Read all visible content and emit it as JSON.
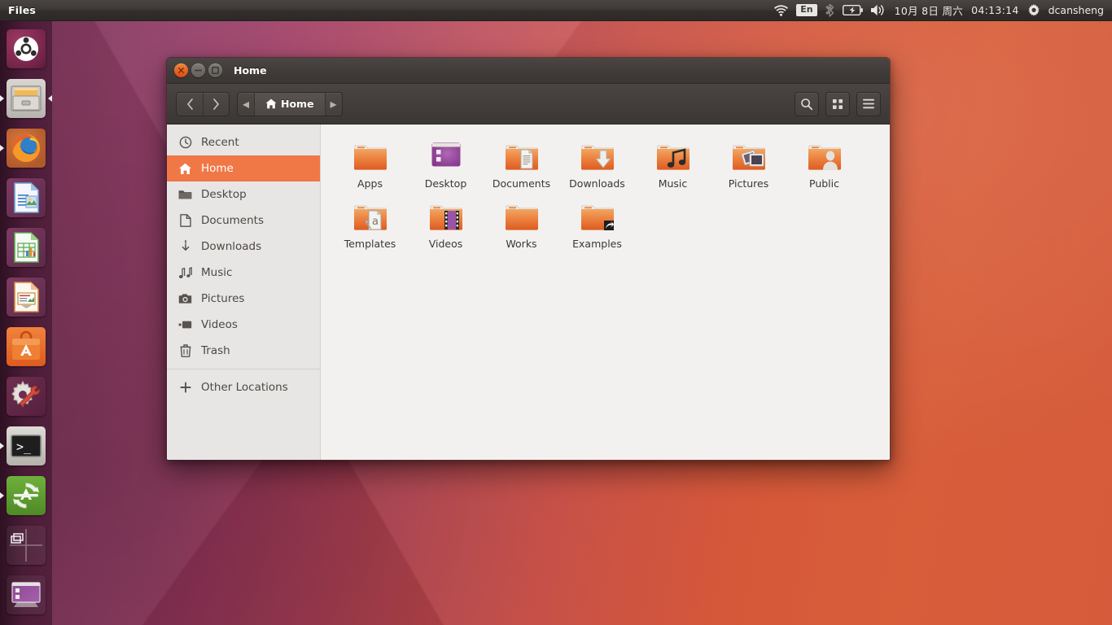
{
  "top_panel": {
    "app_menu_title": "Files",
    "indicators": {
      "wifi_icon": "wifi-icon",
      "keyboard_label": "En",
      "bluetooth_icon": "bluetooth-icon",
      "battery_icon": "battery-charging-icon",
      "volume_icon": "volume-icon",
      "date": "10月 8日 周六",
      "time": "04:13:14",
      "session_icon": "gear-icon",
      "username": "dcansheng"
    }
  },
  "launcher": {
    "items": [
      {
        "name": "dash-home",
        "icon": "ubuntu-logo-icon",
        "running": false,
        "focused": false
      },
      {
        "name": "files",
        "icon": "file-cabinet-icon",
        "running": true,
        "focused": true
      },
      {
        "name": "firefox",
        "icon": "firefox-icon",
        "running": true,
        "focused": false
      },
      {
        "name": "libreoffice-writer",
        "icon": "writer-icon",
        "running": false,
        "focused": false
      },
      {
        "name": "libreoffice-calc",
        "icon": "calc-icon",
        "running": false,
        "focused": false
      },
      {
        "name": "libreoffice-impress",
        "icon": "impress-icon",
        "running": false,
        "focused": false
      },
      {
        "name": "ubuntu-software",
        "icon": "software-center-icon",
        "running": false,
        "focused": false
      },
      {
        "name": "system-settings",
        "icon": "gear-wrench-icon",
        "running": false,
        "focused": false
      },
      {
        "name": "terminal",
        "icon": "terminal-icon",
        "running": true,
        "focused": false
      },
      {
        "name": "software-updater",
        "icon": "updater-icon",
        "running": true,
        "focused": false
      },
      {
        "name": "workspace-switcher",
        "icon": "workspace-switcher-icon",
        "running": false,
        "focused": false
      },
      {
        "name": "show-desktop",
        "icon": "show-desktop-icon",
        "running": false,
        "focused": false
      }
    ]
  },
  "window": {
    "title": "Home",
    "buttons": {
      "close": "close-icon",
      "minimize": "minimize-icon",
      "maximize": "maximize-icon"
    },
    "toolbar": {
      "back_label": "‹",
      "forward_label": "›",
      "path_prev_label": "◂",
      "path_next_label": "▸",
      "breadcrumb": "Home",
      "search_icon": "search-icon",
      "view_grid_icon": "grid-view-icon",
      "menu_icon": "hamburger-menu-icon"
    }
  },
  "sidebar": {
    "items": [
      {
        "label": "Recent",
        "icon": "clock-icon",
        "selected": false
      },
      {
        "label": "Home",
        "icon": "home-icon",
        "selected": true
      },
      {
        "label": "Desktop",
        "icon": "folder-icon",
        "selected": false
      },
      {
        "label": "Documents",
        "icon": "document-icon",
        "selected": false
      },
      {
        "label": "Downloads",
        "icon": "download-icon",
        "selected": false
      },
      {
        "label": "Music",
        "icon": "music-icon",
        "selected": false
      },
      {
        "label": "Pictures",
        "icon": "camera-icon",
        "selected": false
      },
      {
        "label": "Videos",
        "icon": "video-icon",
        "selected": false
      },
      {
        "label": "Trash",
        "icon": "trash-icon",
        "selected": false
      }
    ],
    "other_locations": {
      "label": "Other Locations",
      "icon": "plus-icon"
    }
  },
  "files": [
    {
      "label": "Apps",
      "icon": "folder-plain-icon"
    },
    {
      "label": "Desktop",
      "icon": "folder-desktop-icon"
    },
    {
      "label": "Documents",
      "icon": "folder-documents-icon"
    },
    {
      "label": "Downloads",
      "icon": "folder-downloads-icon"
    },
    {
      "label": "Music",
      "icon": "folder-music-icon"
    },
    {
      "label": "Pictures",
      "icon": "folder-pictures-icon"
    },
    {
      "label": "Public",
      "icon": "folder-public-icon"
    },
    {
      "label": "Templates",
      "icon": "folder-templates-icon"
    },
    {
      "label": "Videos",
      "icon": "folder-videos-icon"
    },
    {
      "label": "Works",
      "icon": "folder-plain-icon"
    },
    {
      "label": "Examples",
      "icon": "folder-symlink-icon"
    }
  ],
  "colors": {
    "accent_orange": "#f07746",
    "ubuntu_orange": "#dd4814",
    "panel_dark": "#3c3835",
    "sidebar_bg": "#e8e6e4",
    "file_area_bg": "#f2f1f0"
  }
}
